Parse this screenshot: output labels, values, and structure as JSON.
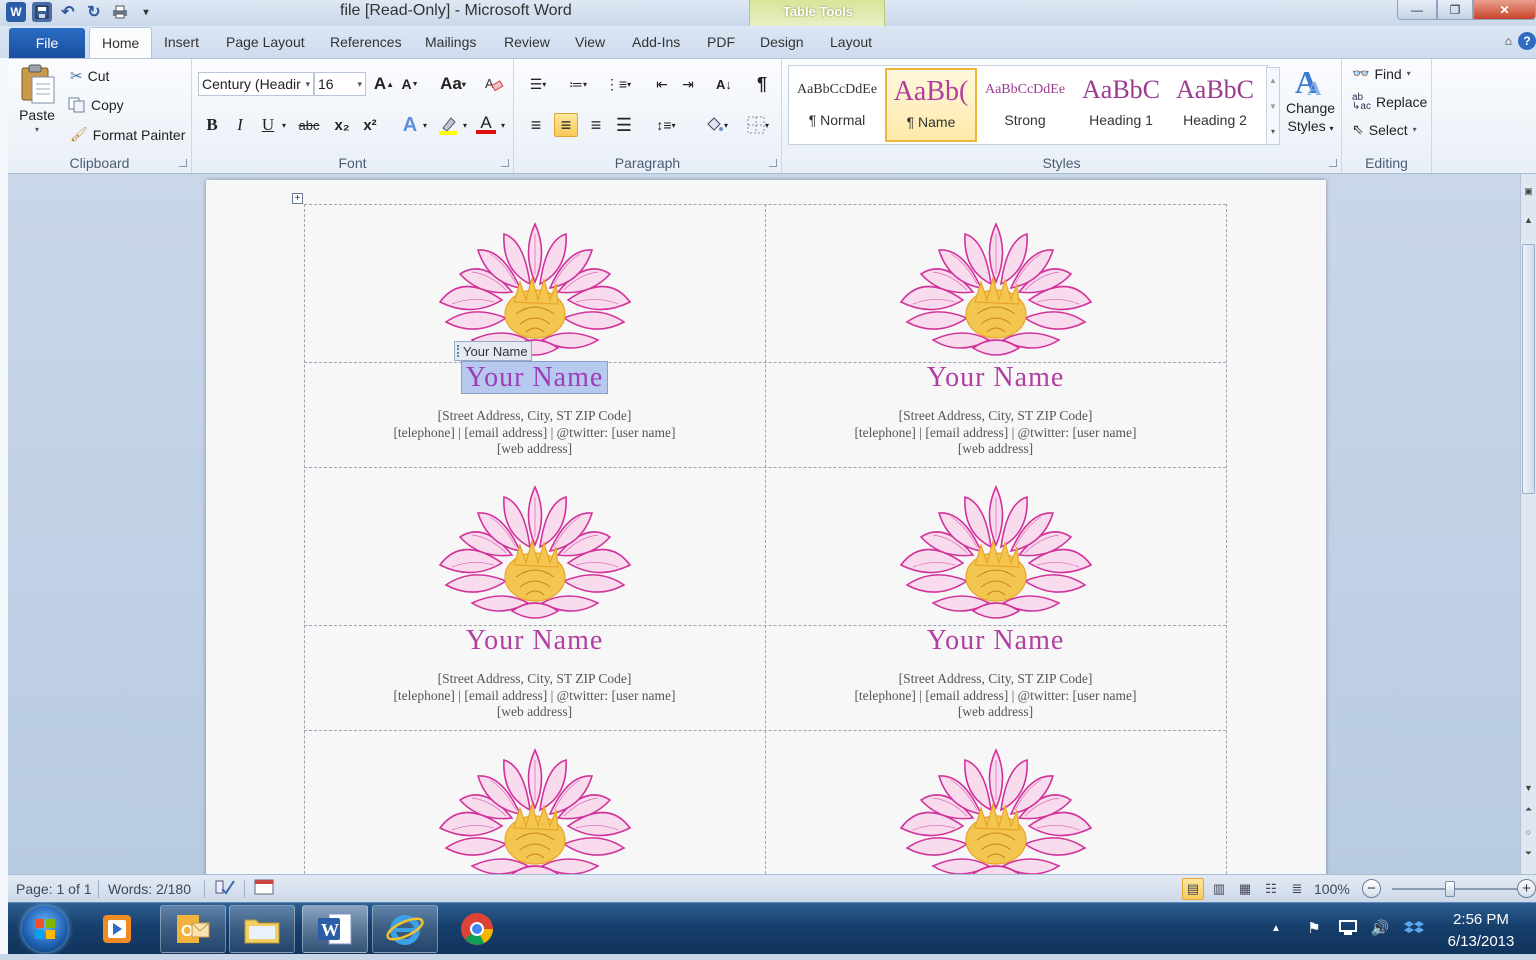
{
  "window": {
    "title": "file [Read-Only]  -  Microsoft Word",
    "context_tab": "Table Tools",
    "minimize": "—",
    "maximize": "❐",
    "close": "✕"
  },
  "tabs": {
    "file": "File",
    "items": [
      "Home",
      "Insert",
      "Page Layout",
      "References",
      "Mailings",
      "Review",
      "View",
      "Add-Ins",
      "PDF",
      "Design",
      "Layout"
    ],
    "active": "Home"
  },
  "ribbon": {
    "clipboard": {
      "label": "Clipboard",
      "paste": "Paste",
      "cut": "Cut",
      "copy": "Copy",
      "format_painter": "Format Painter"
    },
    "font": {
      "label": "Font",
      "font_name": "Century (Headir",
      "font_size": "16",
      "bold": "B",
      "italic": "I",
      "underline": "U",
      "strike": "abc",
      "subscript": "x₂",
      "superscript": "x²",
      "grow": "A",
      "shrink": "A",
      "case": "Aa",
      "font_color": "A",
      "highlight_color": "#ffff00",
      "font_color_value": "#e01010"
    },
    "paragraph": {
      "label": "Paragraph",
      "pilcrow": "¶"
    },
    "styles": {
      "label": "Styles",
      "items": [
        {
          "preview": "AaBbCcDdEe",
          "name": "¶ Normal",
          "color": "#333333"
        },
        {
          "preview": "AaBb(",
          "name": "¶ Name",
          "color": "#b23ea2"
        },
        {
          "preview": "AaBbCcDdEe",
          "name": "Strong",
          "color": "#9b3b8f"
        },
        {
          "preview": "AaBbC",
          "name": "Heading 1",
          "color": "#9b3b8f"
        },
        {
          "preview": "AaBbC",
          "name": "Heading 2",
          "color": "#9b3b8f"
        }
      ],
      "selected_index": 1,
      "change_styles_1": "Change",
      "change_styles_2": "Styles"
    },
    "editing": {
      "label": "Editing",
      "find": "Find",
      "replace": "Replace",
      "select": "Select"
    }
  },
  "document": {
    "cards": [
      {
        "name": "Your Name",
        "address": "[Street Address, City, ST  ZIP Code]",
        "contact": "[telephone]  |  [email address]  |  @twitter: [user name]",
        "web": "[web address]",
        "selected": true
      },
      {
        "name": "Your Name",
        "address": "[Street Address, City, ST  ZIP Code]",
        "contact": "[telephone]  |  [email address]  |  @twitter: [user name]",
        "web": "[web address]",
        "selected": false
      },
      {
        "name": "Your Name",
        "address": "[Street Address, City, ST  ZIP Code]",
        "contact": "[telephone]  |  [email address]  |  @twitter: [user name]",
        "web": "[web address]",
        "selected": false
      },
      {
        "name": "Your Name",
        "address": "[Street Address, City, ST  ZIP Code]",
        "contact": "[telephone]  |  [email address]  |  @twitter: [user name]",
        "web": "[web address]",
        "selected": false
      }
    ],
    "content_control_tag": "Your Name",
    "table_handle": "+",
    "lotus_colors": {
      "petal": "#d2339b",
      "petal_fill": "#f6d3ea",
      "center": "#e9a52a"
    }
  },
  "status": {
    "page": "Page: 1 of 1",
    "words": "Words: 2/180",
    "zoom": "100%",
    "zoom_minus": "−",
    "zoom_plus": "+"
  },
  "taskbar": {
    "time": "2:56 PM",
    "date": "6/13/2013",
    "word_label": "W"
  }
}
